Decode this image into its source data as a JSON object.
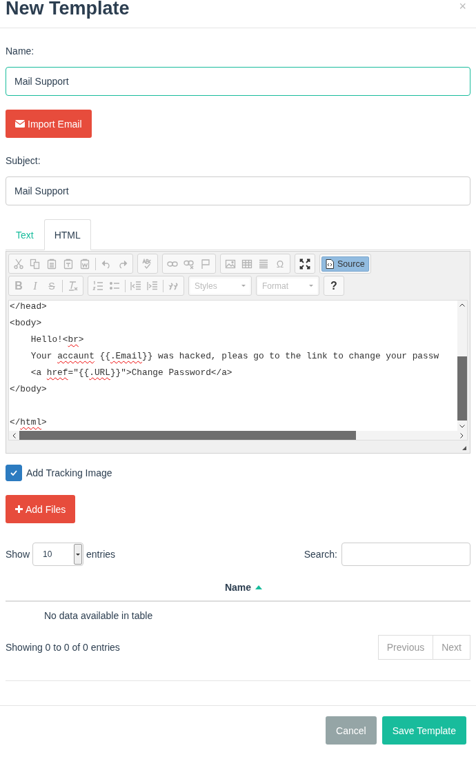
{
  "dialog": {
    "title": "New Template",
    "close": "×"
  },
  "name_field": {
    "label": "Name:",
    "value": "Mail Support",
    "focused": true
  },
  "import_button": {
    "label": "Import Email"
  },
  "subject_field": {
    "label": "Subject:",
    "value": "Mail Support",
    "focused": false
  },
  "tabs": [
    {
      "label": "Text",
      "selected": false
    },
    {
      "label": "HTML",
      "selected": true
    }
  ],
  "editor": {
    "toolbar": [
      [
        [
          {
            "kind": "cut",
            "disabled": true
          },
          {
            "kind": "copy",
            "disabled": true
          },
          {
            "kind": "paste",
            "disabled": true
          },
          {
            "kind": "paste-text",
            "disabled": true
          },
          {
            "kind": "paste-word",
            "disabled": true
          },
          {
            "kind": "separator"
          },
          {
            "kind": "undo",
            "disabled": true
          },
          {
            "kind": "redo",
            "disabled": true
          }
        ],
        [
          {
            "kind": "spellcheck",
            "disabled": true
          }
        ],
        [
          {
            "kind": "link",
            "disabled": true
          },
          {
            "kind": "unlink",
            "disabled": true
          },
          {
            "kind": "anchor",
            "disabled": true
          }
        ],
        [
          {
            "kind": "image",
            "disabled": true
          },
          {
            "kind": "table",
            "disabled": true
          },
          {
            "kind": "hline",
            "disabled": true
          },
          {
            "kind": "glyph",
            "glyph": "Ω",
            "disabled": true
          }
        ],
        [
          {
            "kind": "maximize",
            "disabled": false
          }
        ],
        [
          {
            "kind": "source",
            "label": "Source",
            "selected": true,
            "disabled": false
          }
        ]
      ],
      [
        [
          {
            "kind": "bold",
            "glyph": "B",
            "disabled": true
          },
          {
            "kind": "italic",
            "glyph": "I",
            "disabled": true
          },
          {
            "kind": "strike",
            "glyph": "S",
            "disabled": true
          },
          {
            "kind": "separator"
          },
          {
            "kind": "remove-format",
            "disabled": true
          }
        ],
        [
          {
            "kind": "numbered-list",
            "disabled": true
          },
          {
            "kind": "bulleted-list",
            "disabled": true
          },
          {
            "kind": "separator"
          },
          {
            "kind": "outdent",
            "disabled": true
          },
          {
            "kind": "indent",
            "disabled": true
          },
          {
            "kind": "separator"
          },
          {
            "kind": "blockquote",
            "disabled": true
          }
        ],
        [
          {
            "kind": "combo",
            "label": "Styles",
            "disabled": true
          }
        ],
        [
          {
            "kind": "combo",
            "label": "Format",
            "disabled": true
          }
        ],
        [
          {
            "kind": "bold",
            "glyph": "?",
            "disabled": false
          }
        ]
      ]
    ],
    "code_lines": [
      {
        "kind": "code",
        "segments": [
          {
            "text": "</head>",
            "misspelled": false
          }
        ]
      },
      {
        "kind": "code",
        "segments": [
          {
            "text": "<body>",
            "misspelled": false
          }
        ]
      },
      {
        "kind": "code",
        "segments": [
          {
            "text": "    Hello!<",
            "misspelled": false
          },
          {
            "text": "br",
            "misspelled": true
          },
          {
            "text": ">",
            "misspelled": false
          }
        ]
      },
      {
        "kind": "code",
        "segments": [
          {
            "text": "    Your ",
            "misspelled": false
          },
          {
            "text": "accaunt",
            "misspelled": true
          },
          {
            "text": " {{",
            "misspelled": false
          },
          {
            "text": ".Email",
            "misspelled": true
          },
          {
            "text": "}} was hacked, pleas go to the link to change your passw",
            "misspelled": false
          }
        ]
      },
      {
        "kind": "code",
        "segments": [
          {
            "text": "    <a ",
            "misspelled": false
          },
          {
            "text": "href",
            "misspelled": true
          },
          {
            "text": "=\"{{",
            "misspelled": false
          },
          {
            "text": ".URL",
            "misspelled": true
          },
          {
            "text": "}}\">Change Password</a>",
            "misspelled": false
          }
        ]
      },
      {
        "kind": "code",
        "segments": [
          {
            "text": "</body>",
            "misspelled": false
          }
        ]
      },
      {
        "kind": "blank"
      },
      {
        "kind": "code",
        "segments": [
          {
            "text": "</",
            "misspelled": false
          },
          {
            "text": "html",
            "misspelled": true
          },
          {
            "text": ">",
            "misspelled": false
          }
        ]
      }
    ]
  },
  "tracking": {
    "label": "Add Tracking Image",
    "checked": true
  },
  "add_files_button": {
    "label": "Add Files"
  },
  "table_controls": {
    "show_label": "Show",
    "page_size": "10",
    "entries_label": "entries",
    "search_label": "Search:"
  },
  "table": {
    "columns": [
      {
        "label": "Name",
        "sorted": true
      }
    ],
    "empty_message": "No data available in table"
  },
  "info": "Showing 0 to 0 of 0 entries",
  "pagination": [
    {
      "label": "Previous",
      "disabled": true
    },
    {
      "label": "Next",
      "disabled": true
    }
  ],
  "footer_buttons": [
    {
      "label": "Cancel",
      "kind": "secondary"
    },
    {
      "label": "Save Template",
      "kind": "primary"
    }
  ]
}
